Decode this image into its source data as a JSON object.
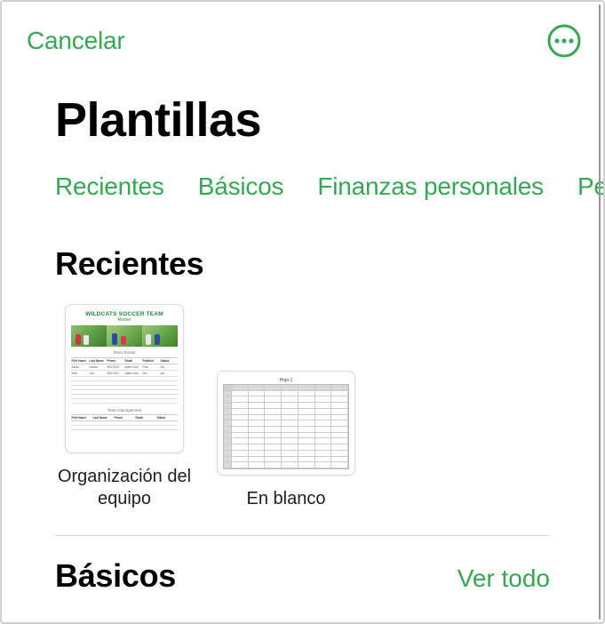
{
  "accent": "#34a853",
  "toolbar": {
    "cancel_label": "Cancelar"
  },
  "page_title": "Plantillas",
  "tabs": [
    {
      "label": "Recientes"
    },
    {
      "label": "Básicos"
    },
    {
      "label": "Finanzas personales"
    },
    {
      "label": "Personal"
    }
  ],
  "sections": {
    "recents": {
      "title": "Recientes",
      "items": [
        {
          "label": "Organización del equipo",
          "thumb": {
            "title": "WILDCATS SOCCER TEAM",
            "subtitle": "Roster",
            "caption1": "Team Roster",
            "section2": "Team Management",
            "headers": [
              "First Name",
              "Last Name",
              "Phone",
              "Email",
              "Position",
              "Status"
            ],
            "headers2": [
              "First Name",
              "Last Name",
              "Phone",
              "Email",
              "Status"
            ]
          }
        },
        {
          "label": "En blanco",
          "thumb": {
            "tab": "Hoja 1"
          }
        }
      ]
    },
    "basics": {
      "title": "Básicos",
      "see_all_label": "Ver todo"
    }
  }
}
